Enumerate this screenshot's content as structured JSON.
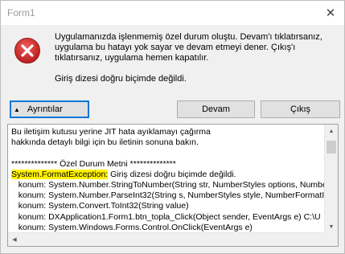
{
  "window": {
    "title": "Form1",
    "close_glyph": "✕"
  },
  "message": {
    "line1": "Uygulamanızda işlenmemiş özel durum oluştu. Devam'ı tıklatırsanız,",
    "line2": "uygulama bu hatayı yok sayar ve devam etmeyi dener. Çıkış'ı",
    "line3": "tıklatırsanız, uygulama hemen kapatılır.",
    "line4": "Giriş dizesi doğru biçimde değildi."
  },
  "buttons": {
    "details_label": "Ayrıntılar",
    "continue_label": "Devam",
    "quit_label": "Çıkış"
  },
  "icons": {
    "error": "error-icon",
    "details_arrow": "arrow-up-icon"
  },
  "details": {
    "line1": "Bu iletişim kutusu yerine JIT hata ayıklamayı çağırma",
    "line2": "hakkında detaylı bilgi için bu iletinin sonuna bakın.",
    "line3": "",
    "line4": "************** Özel Durum Metni **************",
    "line5_highlight": "System.FormatException:",
    "line5_rest": " Giriş dizesi doğru biçimde değildi.",
    "line6": "   konum: System.Number.StringToNumber(String str, NumberStyles options, Numbe",
    "line7": "   konum: System.Number.ParseInt32(String s, NumberStyles style, NumberFormatIn",
    "line8": "   konum: System.Convert.ToInt32(String value)",
    "line9": "   konum: DXApplication1.Form1.btn_topla_Click(Object sender, EventArgs e) C:\\U",
    "line10": "   konum: System.Windows.Forms.Control.OnClick(EventArgs e)"
  },
  "colors": {
    "highlight": "#fff200",
    "error_red": "#d32f2f",
    "focus_blue": "#0078d7"
  }
}
